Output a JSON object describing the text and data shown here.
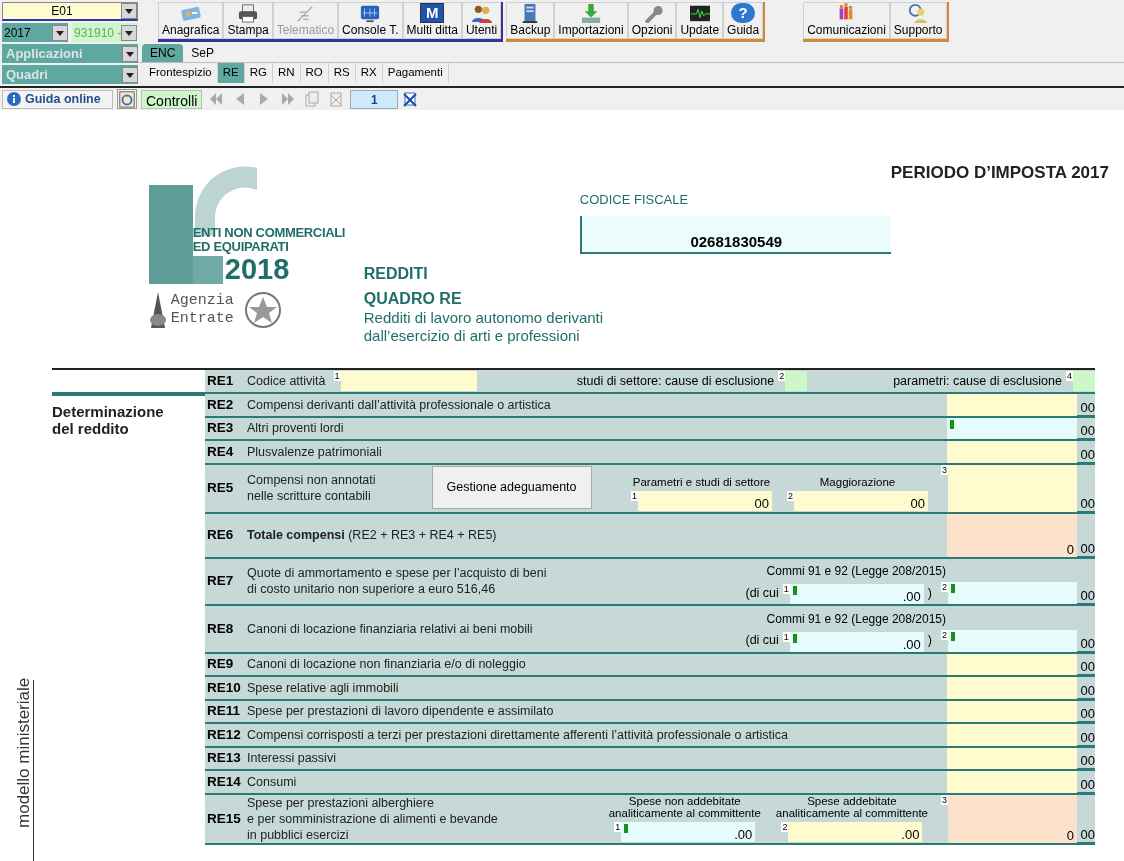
{
  "top": {
    "company": "E01",
    "year": "2017",
    "code": "931910 -",
    "applications": "Applicazioni",
    "sections": "Quadri"
  },
  "toolbar_groups": [
    {
      "color": "#34349a",
      "buttons": [
        {
          "label": "Anagrafica",
          "disabled": false
        },
        {
          "label": "Stampa",
          "disabled": false
        },
        {
          "label": "Telematico",
          "disabled": true
        },
        {
          "label": "Console T.",
          "disabled": false
        },
        {
          "label": "Multi ditta",
          "disabled": false,
          "icon_text": "M"
        },
        {
          "label": "Utenti",
          "disabled": false
        }
      ]
    },
    {
      "color": "#d08a3a",
      "buttons": [
        {
          "label": "Backup",
          "disabled": false
        },
        {
          "label": "Importazioni",
          "disabled": false
        },
        {
          "label": "Opzioni",
          "disabled": false
        },
        {
          "label": "Update",
          "disabled": false
        },
        {
          "label": "Guida",
          "disabled": false,
          "icon_text": "?"
        }
      ]
    },
    {
      "color": "#d08a3a",
      "buttons": [
        {
          "label": "Comunicazioni",
          "disabled": false
        },
        {
          "label": "Supporto",
          "disabled": false
        }
      ]
    }
  ],
  "tabs": [
    {
      "label": "ENC",
      "selected": true
    },
    {
      "label": "SeP",
      "selected": false
    }
  ],
  "quadri_tabs": [
    {
      "label": "Frontespizio",
      "selected": false
    },
    {
      "label": "RE",
      "selected": true
    },
    {
      "label": "RG",
      "selected": false
    },
    {
      "label": "RN",
      "selected": false
    },
    {
      "label": "RO",
      "selected": false
    },
    {
      "label": "RS",
      "selected": false
    },
    {
      "label": "RX",
      "selected": false
    },
    {
      "label": "Pagamenti",
      "selected": false
    }
  ],
  "nav": {
    "help": "Guida online",
    "checks": "Controlli",
    "page": "1"
  },
  "form": {
    "period": "PERIODO D’IMPOSTA 2017",
    "logo_lines": [
      "ENTI NON COMMERCIALI",
      "ED EQUIPARATI"
    ],
    "logo_year": "2018",
    "agency": [
      "Agenzia",
      "Entrate"
    ],
    "codice_label": "CODICE FISCALE",
    "codice": "02681830549",
    "title": "REDDITI",
    "quadro": "QUADRO RE",
    "subtitle": [
      "Redditi di lavoro autonomo derivanti",
      "dall’esercizio di arti e professioni"
    ],
    "side_label": "modello ministeriale",
    "section": "Determinazione del reddito",
    "rows": [
      {
        "code": "RE1",
        "kind": "codes",
        "label": [
          "Codice attività"
        ],
        "fields": [
          {
            "num": "1",
            "color": "#fefccf"
          },
          {
            "caption": "studi di settore: cause di esclusione",
            "num": "2",
            "color": "#ccf7c8"
          },
          {
            "caption": "parametri: cause di esclusione",
            "num": "4",
            "color": "#ccf7c8"
          }
        ]
      },
      {
        "code": "RE2",
        "kind": "amount",
        "label": [
          "Compensi derivanti dall’attività professionale o artistica"
        ],
        "amount": {
          "color": "#fefccf",
          "cents": "00"
        }
      },
      {
        "code": "RE3",
        "kind": "amount",
        "label": [
          "Altri proventi lordi"
        ],
        "amount": {
          "color": "#e6fbfb",
          "flag": true,
          "cents": "00"
        }
      },
      {
        "code": "RE4",
        "kind": "amount",
        "label": [
          "Plusvalenze patrimoniali"
        ],
        "amount": {
          "color": "#fefccf",
          "cents": "00"
        }
      },
      {
        "code": "RE5",
        "kind": "adjust",
        "label": [
          "Compensi non annotati",
          "nelle scritture contabili"
        ],
        "button": "Gestione adeguamento",
        "fields": [
          {
            "heading": [
              "Parametri e studi di settore"
            ],
            "num": "1",
            "color": "#fefccf",
            "value": "00"
          },
          {
            "heading": [
              "Maggiorazione"
            ],
            "num": "2",
            "color": "#fefccf",
            "value": "00"
          }
        ],
        "amount": {
          "num": "3",
          "color": "#fefccf",
          "cents": "00"
        }
      },
      {
        "code": "RE6",
        "kind": "total",
        "label": [
          "**Totale compensi** (RE2 + RE3 + RE4 + RE5)"
        ],
        "amount": {
          "color": "#fde2cb",
          "value": "0",
          "cents": "00"
        }
      },
      {
        "code": "RE7",
        "kind": "split",
        "label": [
          "Quote di ammortamento e spese per l’acquisto di beni",
          "di costo unitario non superiore a euro 516,46"
        ],
        "note": "Commi 91 e 92 (Legge 208/2015)",
        "open": "(di cui",
        "close": ")",
        "fields": [
          {
            "num": "1",
            "flag": true,
            "color": "#e6fbfb",
            "value": ".00"
          }
        ],
        "amount": {
          "num": "2",
          "flag": true,
          "color": "#e6fbfb",
          "cents": "00"
        }
      },
      {
        "code": "RE8",
        "kind": "split",
        "label": [
          "Canoni di locazione finanziaria relativi ai beni mobili"
        ],
        "note": "Commi 91 e 92 (Legge 208/2015)",
        "open": "(di cui",
        "close": ")",
        "fields": [
          {
            "num": "1",
            "flag": true,
            "color": "#e6fbfb",
            "value": ".00"
          }
        ],
        "amount": {
          "num": "2",
          "flag": true,
          "color": "#e6fbfb",
          "cents": "00"
        }
      },
      {
        "code": "RE9",
        "kind": "amount",
        "label": [
          "Canoni di locazione non finanziaria e/o di noleggio"
        ],
        "amount": {
          "color": "#fefccf",
          "cents": "00"
        }
      },
      {
        "code": "RE10",
        "kind": "amount",
        "label": [
          "Spese relative agli immobili"
        ],
        "amount": {
          "color": "#fefccf",
          "cents": "00"
        }
      },
      {
        "code": "RE11",
        "kind": "amount",
        "label": [
          "Spese per prestazioni di lavoro dipendente e assimilato"
        ],
        "amount": {
          "color": "#fefccf",
          "cents": "00"
        }
      },
      {
        "code": "RE12",
        "kind": "amount",
        "label": [
          "Compensi corrisposti a terzi per prestazioni direttamente afferenti l’attività professionale o artistica"
        ],
        "amount": {
          "color": "#fefccf",
          "cents": "00"
        }
      },
      {
        "code": "RE13",
        "kind": "amount",
        "label": [
          "Interessi passivi"
        ],
        "amount": {
          "color": "#fefccf",
          "cents": "00"
        }
      },
      {
        "code": "RE14",
        "kind": "amount",
        "label": [
          "Consumi"
        ],
        "amount": {
          "color": "#fefccf",
          "cents": "00"
        }
      },
      {
        "code": "RE15",
        "kind": "adjust",
        "label": [
          "Spese per prestazioni alberghiere",
          "e per somministrazione di alimenti e bevande",
          "in pubblici esercizi"
        ],
        "fields": [
          {
            "heading": [
              "Spese non addebitate",
              "analiticamente al committente"
            ],
            "num": "1",
            "flag": true,
            "color": "#e6fbfb",
            "value": ".00"
          },
          {
            "heading": [
              "Spese addebitate",
              "analiticamente al committente"
            ],
            "num": "2",
            "color": "#fefccf",
            "value": ".00"
          }
        ],
        "amount": {
          "num": "3",
          "color": "#fde2cb",
          "value": "0",
          "cents": "00"
        }
      }
    ]
  }
}
